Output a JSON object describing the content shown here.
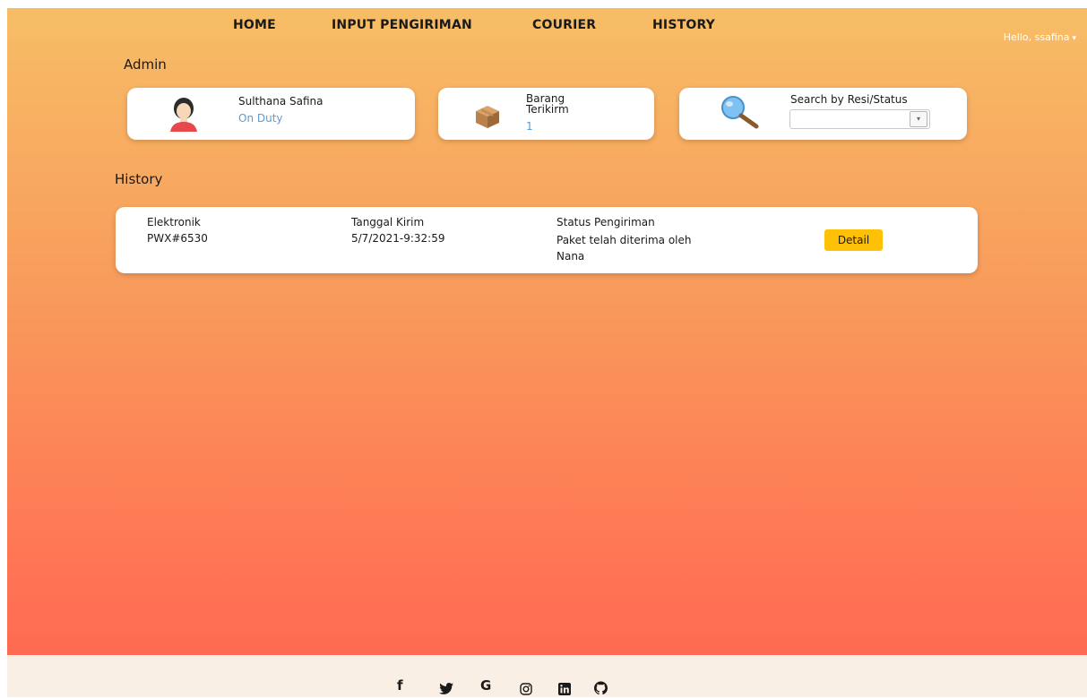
{
  "nav": {
    "home": "HOME",
    "input": "INPUT PENGIRIMAN",
    "courier": "COURIER",
    "history": "HISTORY"
  },
  "user_menu": {
    "label": "Hello, ssafina",
    "caret": "▾"
  },
  "sections": {
    "admin": "Admin",
    "history": "History"
  },
  "profile": {
    "name": "Sulthana Safina",
    "status": "On Duty"
  },
  "items": {
    "label": "Barang Terikirm",
    "count": "1"
  },
  "search": {
    "label": "Search by Resi/Status",
    "value": "",
    "dropdown_glyph": "▾"
  },
  "history_rows": [
    {
      "type": "Elektronik",
      "code": "PWX#6530",
      "date_label": "Tanggal Kirim",
      "date": "5/7/2021-9:32:59",
      "status_label": "Status Pengiriman",
      "status": "Paket telah diterima oleh Nana",
      "action": "Detail"
    }
  ],
  "footer": {
    "icons": {
      "facebook": "f",
      "twitter": "🐦",
      "google": "G",
      "instagram": "◎",
      "linkedin": "in",
      "github": "◯"
    }
  },
  "colors": {
    "gradient_top": "#f7bd66",
    "gradient_bottom": "#ff6a52",
    "accent_blue": "#5b9bd5",
    "button_yellow": "#ffc107",
    "footer_bg": "#f9efe4"
  }
}
